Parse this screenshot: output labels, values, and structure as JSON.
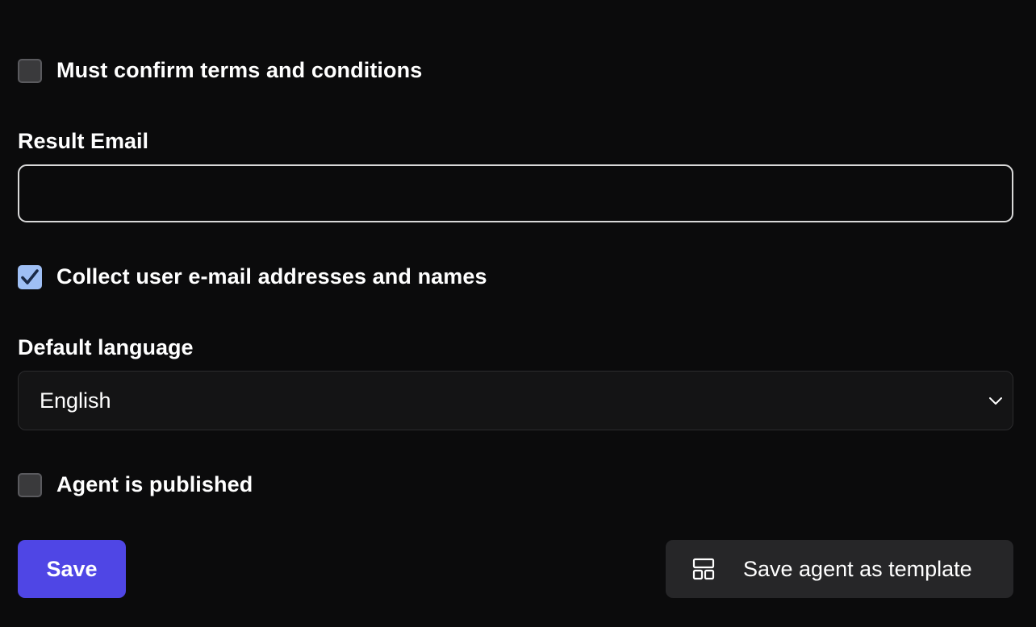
{
  "form": {
    "terms_checkbox": {
      "label": "Must confirm terms and conditions",
      "checked": false
    },
    "result_email": {
      "label": "Result Email",
      "value": "",
      "placeholder": ""
    },
    "collect_checkbox": {
      "label": "Collect user e-mail addresses and names",
      "checked": true
    },
    "default_language": {
      "label": "Default language",
      "selected": "English"
    },
    "published_checkbox": {
      "label": "Agent is published",
      "checked": false
    }
  },
  "actions": {
    "save_label": "Save",
    "template_label": "Save agent as template",
    "template_icon": "layout-template-icon"
  },
  "colors": {
    "background": "#0b0b0c",
    "primary": "#4f46e5",
    "checkbox_checked": "#9fbff5",
    "secondary_button": "#262628"
  }
}
